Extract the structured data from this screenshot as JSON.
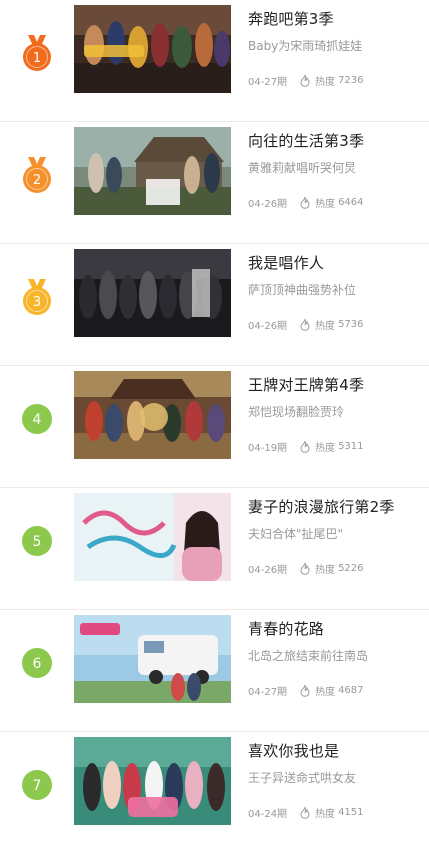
{
  "colors": {
    "rank1": "#f26b1d",
    "rank2": "#f5902a",
    "rank3": "#f7b52a",
    "rank_other": "#8cc84b"
  },
  "items": [
    {
      "rank": "1",
      "title": "奔跑吧第3季",
      "subtitle": "Baby为宋雨琦抓娃娃",
      "issue": "04-27期",
      "heat_label": "热度",
      "heat": "7236",
      "thumb_text": "",
      "badge": "medal"
    },
    {
      "rank": "2",
      "title": "向往的生活第3季",
      "subtitle": "黄雅莉献唱听哭何炅",
      "issue": "04-26期",
      "heat_label": "热度",
      "heat": "6464",
      "thumb_text": "",
      "badge": "medal"
    },
    {
      "rank": "3",
      "title": "我是唱作人",
      "subtitle": "萨顶顶神曲强势补位",
      "issue": "04-26期",
      "heat_label": "热度",
      "heat": "5736",
      "thumb_text": "",
      "badge": "medal"
    },
    {
      "rank": "4",
      "title": "王牌对王牌第4季",
      "subtitle": "郑恺现场翻脸贾玲",
      "issue": "04-19期",
      "heat_label": "热度",
      "heat": "5311",
      "thumb_text": "",
      "badge": "circle"
    },
    {
      "rank": "5",
      "title": "妻子的浪漫旅行第2季",
      "subtitle": "夫妇合体\"扯尾巴\"",
      "issue": "04-26期",
      "heat_label": "热度",
      "heat": "5226",
      "thumb_text": "",
      "badge": "circle"
    },
    {
      "rank": "6",
      "title": "青春的花路",
      "subtitle": "北岛之旅结束前往南岛",
      "issue": "04-27期",
      "heat_label": "热度",
      "heat": "4687",
      "thumb_text": "",
      "badge": "circle"
    },
    {
      "rank": "7",
      "title": "喜欢你我也是",
      "subtitle": "王子异送命式哄女友",
      "issue": "04-24期",
      "heat_label": "热度",
      "heat": "4151",
      "thumb_text": "",
      "badge": "circle"
    }
  ]
}
